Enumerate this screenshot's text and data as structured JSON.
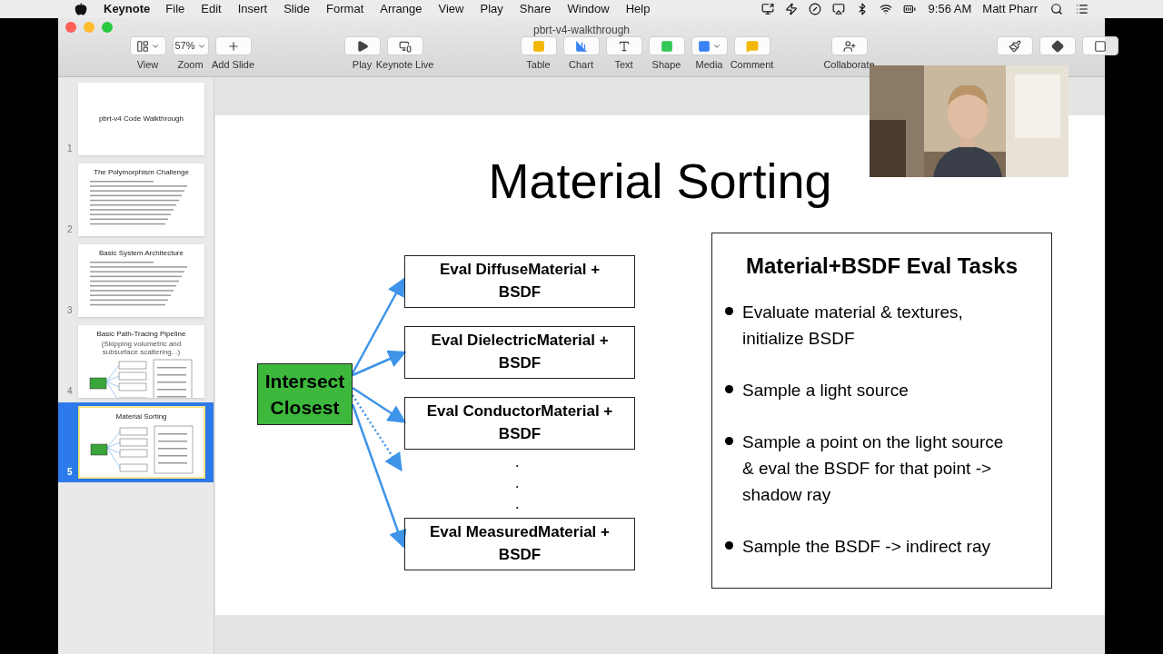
{
  "menu_bar": {
    "app_name": "Keynote",
    "items": [
      "File",
      "Edit",
      "Insert",
      "Slide",
      "Format",
      "Arrange",
      "View",
      "Play",
      "Share",
      "Window",
      "Help"
    ],
    "time": "9:56 AM",
    "user": "Matt Pharr"
  },
  "window": {
    "title": "pbrt-v4-walkthrough"
  },
  "toolbar": {
    "groups": [
      [
        {
          "kind": "view",
          "label": "View"
        },
        {
          "kind": "zoom",
          "label": "Zoom",
          "value": "57%"
        },
        {
          "kind": "add",
          "label": "Add Slide"
        }
      ],
      [
        {
          "kind": "play",
          "label": "Play"
        },
        {
          "kind": "live",
          "label": "Keynote Live"
        }
      ],
      [
        {
          "kind": "table",
          "label": "Table"
        },
        {
          "kind": "chart",
          "label": "Chart"
        },
        {
          "kind": "text",
          "label": "Text"
        },
        {
          "kind": "shape",
          "label": "Shape"
        },
        {
          "kind": "media",
          "label": "Media"
        },
        {
          "kind": "comment",
          "label": "Comment"
        }
      ],
      [
        {
          "kind": "collaborate",
          "label": "Collaborate"
        }
      ],
      [
        {
          "kind": "format"
        },
        {
          "kind": "animate"
        },
        {
          "kind": "document"
        }
      ]
    ]
  },
  "slides": [
    {
      "number": "1",
      "title": "pbrt-v4 Code Walkthrough",
      "kind": "title",
      "selected": false
    },
    {
      "number": "2",
      "title": "The Polymorphism Challenge",
      "kind": "bullets",
      "selected": false
    },
    {
      "number": "3",
      "title": "Basic System Architecture",
      "kind": "bullets",
      "selected": false
    },
    {
      "number": "4",
      "title": "Basic Path-Tracing Pipeline",
      "subtitle": "(Skipping volumetric and subsurface scattering...)",
      "kind": "diagram",
      "selected": false
    },
    {
      "number": "5",
      "title": "Material Sorting",
      "kind": "diagram",
      "selected": true
    }
  ],
  "slide": {
    "title": "Material Sorting",
    "source": "Intersect Closest",
    "targets": [
      "Eval DiffuseMaterial + BSDF",
      "Eval DielectricMaterial + BSDF",
      "Eval ConductorMaterial + BSDF",
      "Eval MeasuredMaterial + BSDF"
    ],
    "dots": [
      "•",
      "•",
      "•"
    ],
    "arrows": [
      {
        "kind": "solid"
      },
      {
        "kind": "solid"
      },
      {
        "kind": "solid"
      },
      {
        "kind": "dotted"
      },
      {
        "kind": "solid"
      }
    ],
    "panel": {
      "title": "Material+BSDF Eval Tasks",
      "bullets": [
        "Evaluate material & textures, initialize BSDF",
        "Sample a light source",
        "Sample a point on the light source & eval the BSDF for that point -> shadow ray",
        "Sample the BSDF -> indirect ray"
      ]
    }
  }
}
